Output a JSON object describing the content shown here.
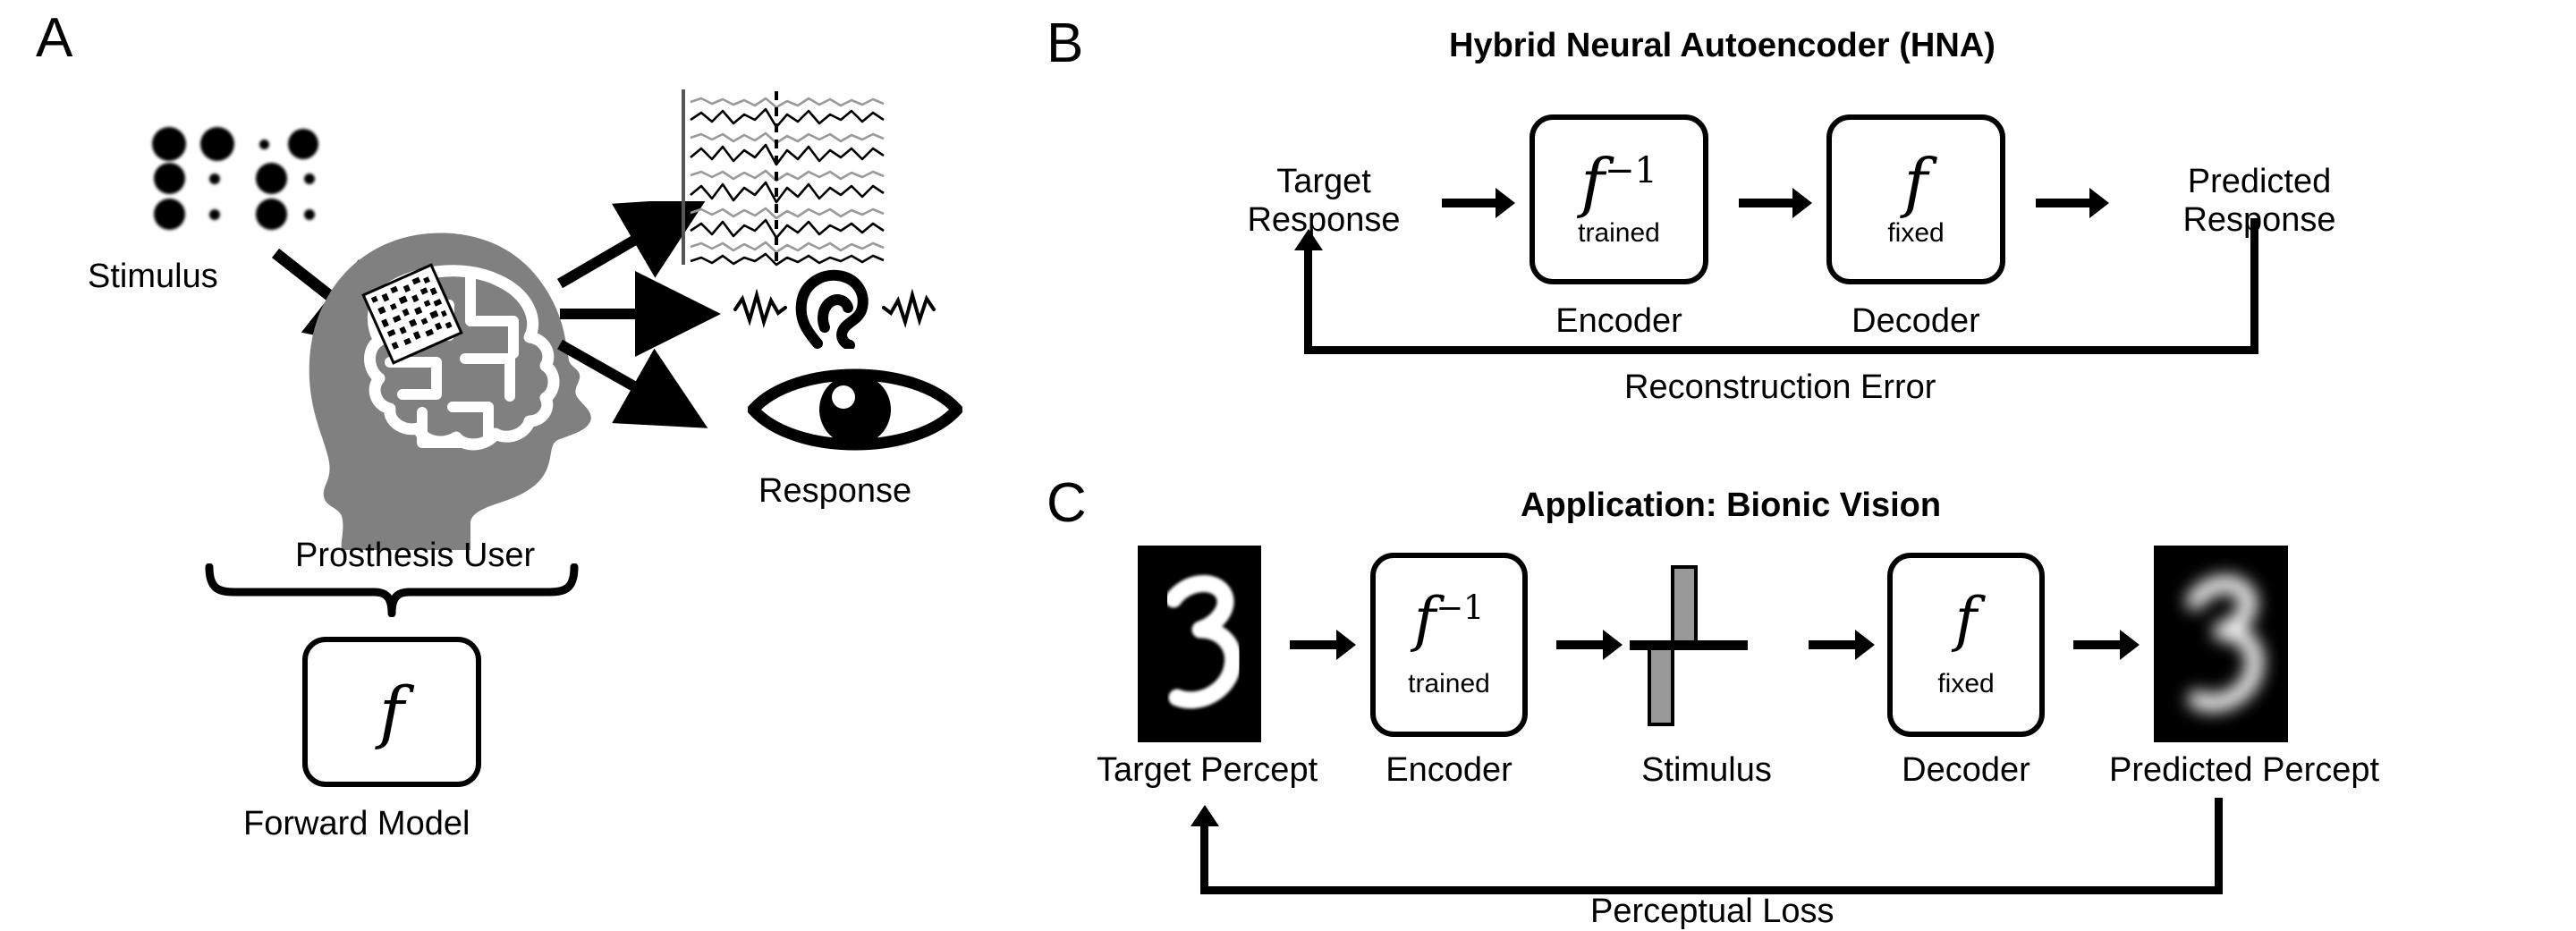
{
  "figure": {
    "background": "#ffffff",
    "ink": "#000000",
    "head_gray": "#808080",
    "pulse_gray": "#999999",
    "trace_gray": "#9a9a9a"
  },
  "panelA": {
    "letter": "A",
    "stimulus_label": "Stimulus",
    "user_label": "Prosthesis User",
    "response_label": "Response",
    "forward_model_label": "Forward Model",
    "forward_model_symbol": "f",
    "icons": {
      "implant": "electrode-array-icon",
      "brain": "brain-icon",
      "head": "head-silhouette-icon",
      "recording": "neural-traces-icon",
      "ear": "ear-icon",
      "eye": "eye-icon",
      "stimulus_grid": "phosphene-dot-grid-icon",
      "brace": "curly-brace-icon",
      "implant_arrow": "implant-arrow-icon"
    },
    "stimulus_dots": [
      [
        1.0,
        1.0,
        0.22,
        0.92
      ],
      [
        0.92,
        0.22,
        0.92,
        0.22
      ],
      [
        0.92,
        0.22,
        0.92,
        0.22
      ]
    ],
    "response_arrows": 3,
    "trace_count": 10
  },
  "panelB": {
    "letter": "B",
    "title": "Hybrid Neural Autoencoder (HNA)",
    "input_label": "Target\nResponse",
    "input_line1": "Target",
    "input_line2": "Response",
    "output_line1": "Predicted",
    "output_line2": "Response",
    "encoder": {
      "symbol": "f",
      "exponent": "−1",
      "state": "trained",
      "caption": "Encoder"
    },
    "decoder": {
      "symbol": "f",
      "exponent": "",
      "state": "fixed",
      "caption": "Decoder"
    },
    "feedback_label": "Reconstruction Error",
    "arrow_count": 3
  },
  "panelC": {
    "letter": "C",
    "title": "Application: Bionic Vision",
    "target_caption": "Target Percept",
    "encoder_caption": "Encoder",
    "stimulus_caption": "Stimulus",
    "decoder_caption": "Decoder",
    "predicted_caption": "Predicted Percept",
    "encoder": {
      "symbol": "f",
      "exponent": "−1",
      "state": "trained"
    },
    "decoder": {
      "symbol": "f",
      "exponent": "",
      "state": "fixed"
    },
    "feedback_label": "Perceptual Loss",
    "target_digit": "3",
    "predicted_digit": "3",
    "icons": {
      "target_percept": "mnist-digit-image",
      "predicted_percept": "blurred-digit-image",
      "stimulus_pulse": "biphasic-pulse-icon"
    },
    "arrow_count": 4
  }
}
